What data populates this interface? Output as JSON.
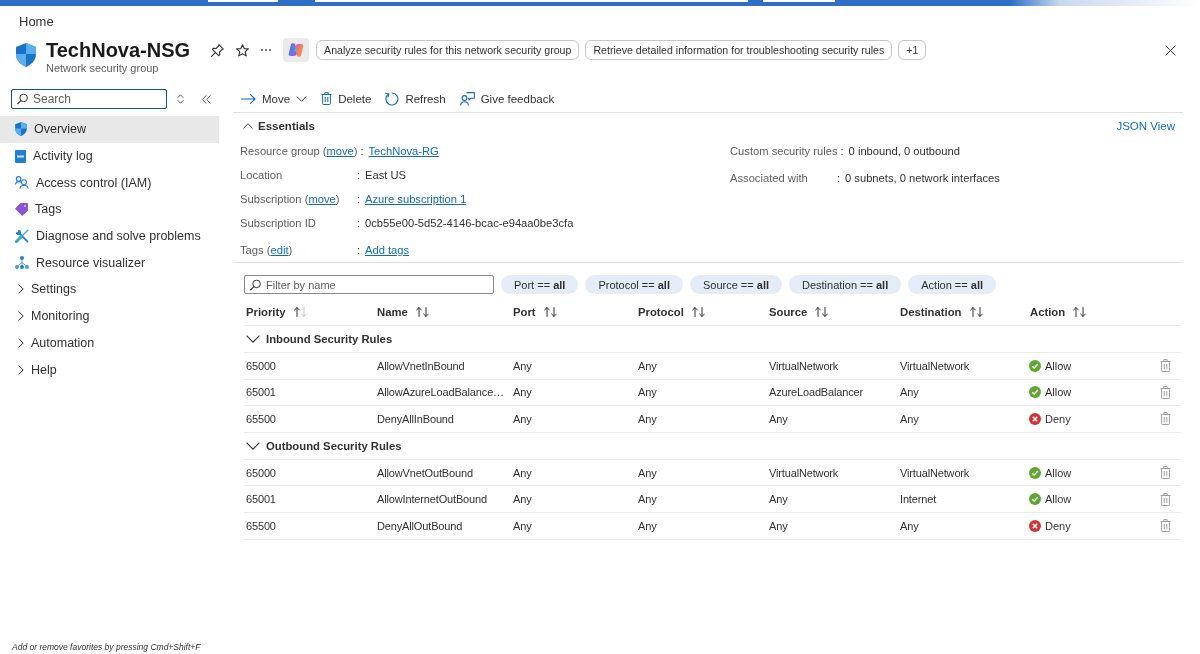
{
  "breadcrumb": "Home",
  "resource": {
    "title": "TechNova-NSG",
    "subtitle": "Network security group"
  },
  "suggestions": [
    "Analyze security rules for this network security group",
    "Retrieve detailed information for troubleshooting security rules",
    "+1"
  ],
  "sidebar": {
    "search": {
      "placeholder": "Search"
    },
    "items": [
      {
        "label": "Overview",
        "kind": "page",
        "selected": true
      },
      {
        "label": "Activity log",
        "kind": "page",
        "selected": false
      },
      {
        "label": "Access control (IAM)",
        "kind": "page",
        "selected": false
      },
      {
        "label": "Tags",
        "kind": "page",
        "selected": false
      },
      {
        "label": "Diagnose and solve problems",
        "kind": "page",
        "selected": false
      },
      {
        "label": "Resource visualizer",
        "kind": "page",
        "selected": false
      },
      {
        "label": "Settings",
        "kind": "group",
        "expanded": false,
        "selected": false
      },
      {
        "label": "Monitoring",
        "kind": "group",
        "expanded": false,
        "selected": false
      },
      {
        "label": "Automation",
        "kind": "group",
        "expanded": false,
        "selected": false
      },
      {
        "label": "Help",
        "kind": "group",
        "expanded": false,
        "selected": false
      }
    ]
  },
  "toolbar": [
    {
      "label": "Move",
      "has_menu": true
    },
    {
      "label": "Delete",
      "has_menu": false
    },
    {
      "label": "Refresh",
      "has_menu": false
    },
    {
      "label": "Give feedback",
      "has_menu": false
    }
  ],
  "essentials": {
    "title": "Essentials",
    "expanded": true,
    "link": "JSON View",
    "left": [
      {
        "label": "Resource group (",
        "label_link": "move",
        "label_end": ")",
        "separator": ":",
        "value": "TechNova-RG",
        "kind": "link"
      },
      {
        "label": "Location",
        "separator": ":",
        "value": "East US",
        "kind": "text"
      },
      {
        "label": "Subscription (",
        "label_link": "move",
        "label_end": ")",
        "separator": ":",
        "value": "Azure subscription 1",
        "kind": "link"
      },
      {
        "label": "Subscription ID",
        "separator": ":",
        "value": "0cb55e00-5d52-4146-bcac-e94aa0be3cfa",
        "kind": "text"
      },
      {
        "label": "Tags (",
        "label_link": "edit",
        "label_end": ")",
        "separator": ":",
        "value": "Add tags",
        "kind": "link"
      }
    ],
    "right": [
      {
        "label": "Custom security rules",
        "separator": ":",
        "value": "0 inbound, 0 outbound",
        "kind": "text"
      },
      {
        "label": "Associated with",
        "separator": ":",
        "value": "0 subnets, 0 network interfaces",
        "kind": "text"
      }
    ]
  },
  "filters": {
    "search": {
      "placeholder": "Filter by name"
    },
    "chips": [
      "Port == **all**",
      "Protocol == **all**",
      "Source == **all**",
      "Destination == **all**",
      "Action == **all**"
    ]
  },
  "table": {
    "columns": [
      {
        "label": "Priority",
        "sorted": true
      },
      {
        "label": "Name",
        "sorted": false
      },
      {
        "label": "Port",
        "sorted": false
      },
      {
        "label": "Protocol",
        "sorted": false
      },
      {
        "label": "Source",
        "sorted": false
      },
      {
        "label": "Destination",
        "sorted": false
      },
      {
        "label": "Action",
        "sorted": false
      }
    ],
    "groups": [
      {
        "title": "Inbound Security Rules",
        "expanded": true,
        "rows": [
          {
            "priority": "65000",
            "name": "AllowVnetInBound",
            "port": "Any",
            "protocol": "Any",
            "source": "VirtualNetwork",
            "destination": "VirtualNetwork",
            "action": "Allow",
            "kind": "allow"
          },
          {
            "priority": "65001",
            "name": "AllowAzureLoadBalance…",
            "port": "Any",
            "protocol": "Any",
            "source": "AzureLoadBalancer",
            "destination": "Any",
            "action": "Allow",
            "kind": "allow"
          },
          {
            "priority": "65500",
            "name": "DenyAllInBound",
            "port": "Any",
            "protocol": "Any",
            "source": "Any",
            "destination": "Any",
            "action": "Deny",
            "kind": "deny"
          }
        ]
      },
      {
        "title": "Outbound Security Rules",
        "expanded": true,
        "rows": [
          {
            "priority": "65000",
            "name": "AllowVnetOutBound",
            "port": "Any",
            "protocol": "Any",
            "source": "VirtualNetwork",
            "destination": "VirtualNetwork",
            "action": "Allow",
            "kind": "allow"
          },
          {
            "priority": "65001",
            "name": "AllowInternetOutBound",
            "port": "Any",
            "protocol": "Any",
            "source": "Any",
            "destination": "Internet",
            "action": "Allow",
            "kind": "allow"
          },
          {
            "priority": "65500",
            "name": "DenyAllOutBound",
            "port": "Any",
            "protocol": "Any",
            "source": "Any",
            "destination": "Any",
            "action": "Deny",
            "kind": "deny"
          }
        ]
      }
    ]
  },
  "footer_hint": "Add or remove favorites by pressing Cmd+Shift+F"
}
